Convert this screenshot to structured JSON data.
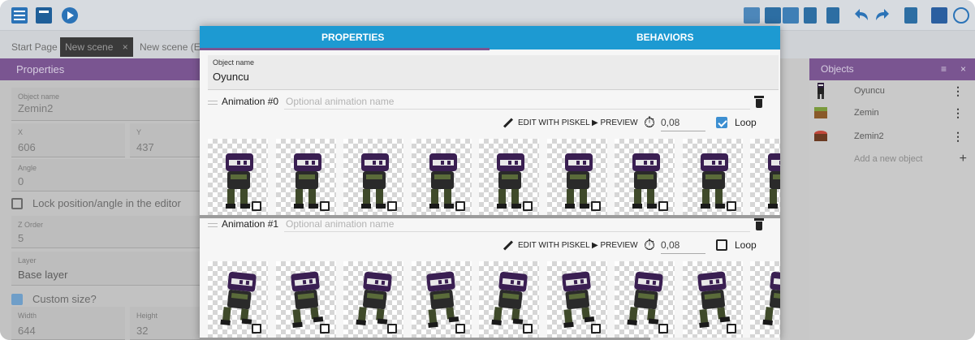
{
  "colors": {
    "accent": "#1d9ad2",
    "header_purple": "#7a5591",
    "loop_checked": "#3d8fd1"
  },
  "icons": {
    "toolbar_left": [
      "project-manager-icon",
      "scene-list-icon",
      "play-icon"
    ],
    "toolbar_right": [
      "grid-icon",
      "settings-icon",
      "layers-icon",
      "list-icon",
      "copy-icon",
      "undo-icon",
      "redo-icon",
      "delete-icon",
      "tile-icon",
      "zoom-icon"
    ]
  },
  "tabs": [
    {
      "label": "Start Page"
    },
    {
      "label": "New scene"
    },
    {
      "label": "New scene (Eve"
    }
  ],
  "properties_panel": {
    "title": "Properties",
    "object_name_label": "Object name",
    "object_name_value": "Zemin2",
    "x_label": "X",
    "x_value": "606",
    "y_label": "Y",
    "y_value": "437",
    "angle_label": "Angle",
    "angle_value": "0",
    "lock_label": "Lock position/angle in the editor",
    "zorder_label": "Z Order",
    "zorder_value": "5",
    "layer_label": "Layer",
    "layer_value": "Base layer",
    "custom_size_label": "Custom size?",
    "width_label": "Width",
    "width_value": "644",
    "height_label": "Height",
    "height_value": "32"
  },
  "objects_panel": {
    "title": "Objects",
    "items": [
      {
        "name": "Oyuncu",
        "icon": "ninja-sprite-icon"
      },
      {
        "name": "Zemin",
        "icon": "ground-tile-icon"
      },
      {
        "name": "Zemin2",
        "icon": "ground-tile-icon"
      }
    ],
    "add_label": "Add a new object"
  },
  "dialog": {
    "tabs": [
      {
        "label": "PROPERTIES"
      },
      {
        "label": "BEHAVIORS"
      }
    ],
    "active_tab": "PROPERTIES",
    "object_name_label": "Object name",
    "object_name_value": "Oyuncu",
    "animations": [
      {
        "name": "Animation #0",
        "placeholder": "Optional animation name",
        "edit_label": "EDIT WITH PISKEL",
        "preview_label": "PREVIEW",
        "speed": "0,08",
        "loop_label": "Loop",
        "loop": true,
        "frames": 9,
        "pose": "standing"
      },
      {
        "name": "Animation #1",
        "placeholder": "Optional animation name",
        "edit_label": "EDIT WITH PISKEL",
        "preview_label": "PREVIEW",
        "speed": "0,08",
        "loop_label": "Loop",
        "loop": false,
        "frames": 9,
        "pose": "running"
      }
    ]
  }
}
